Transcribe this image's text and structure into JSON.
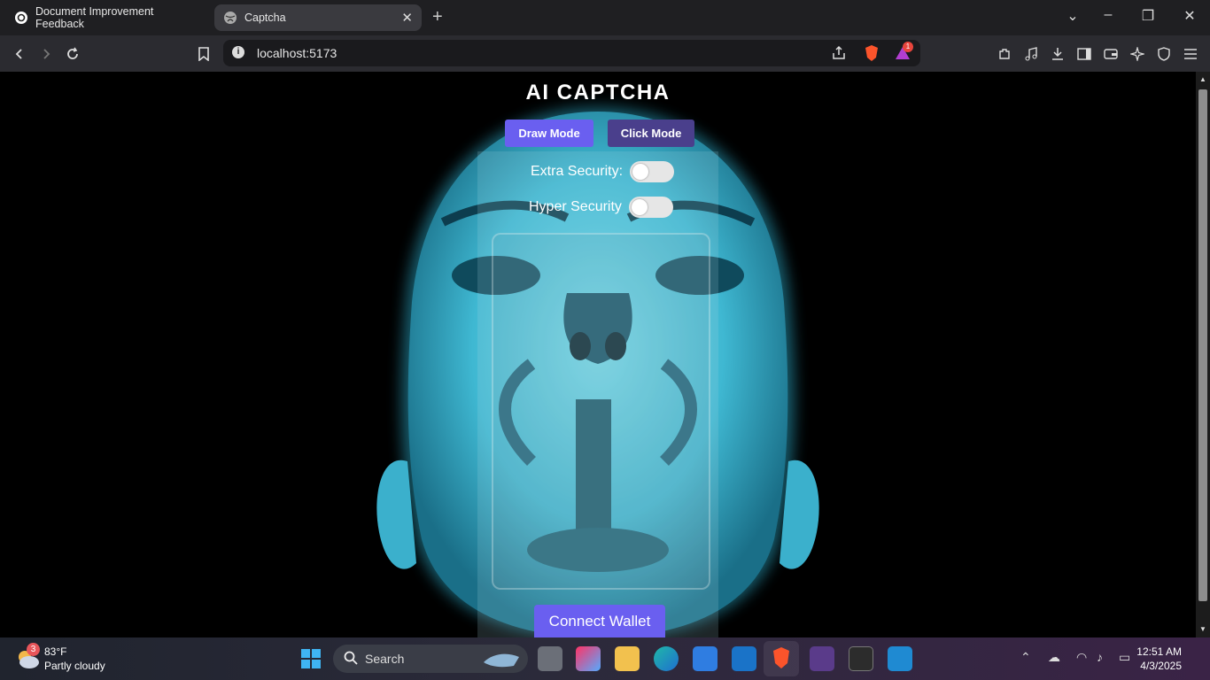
{
  "browser": {
    "tabs": [
      {
        "label": "Document Improvement Feedback"
      },
      {
        "label": "Captcha"
      }
    ],
    "url": "localhost:5173",
    "alert_badge": "1"
  },
  "page": {
    "title": "AI CAPTCHA",
    "draw_mode": "Draw Mode",
    "click_mode": "Click Mode",
    "extra_security": "Extra Security:",
    "hyper_security": "Hyper Security",
    "connect_wallet": "Connect Wallet",
    "colors": {
      "accent": "#6a5ff0",
      "accent_dark": "#4a3f8c",
      "glow": "#4fd6e8"
    }
  },
  "taskbar": {
    "temperature": "83°F",
    "weather": "Partly cloudy",
    "weather_badge": "3",
    "search": "Search",
    "time": "12:51 AM",
    "date": "4/3/2025"
  }
}
